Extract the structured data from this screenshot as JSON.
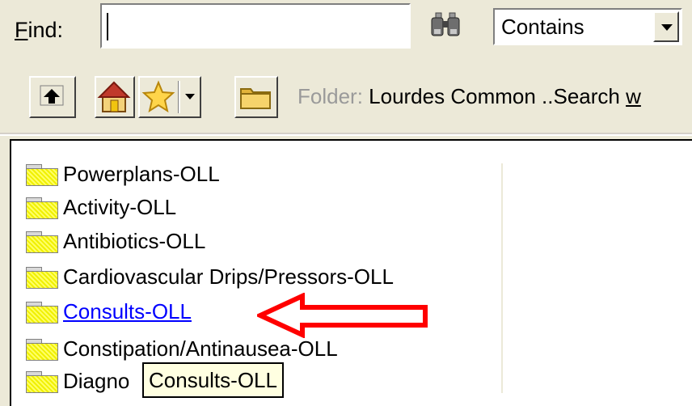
{
  "find": {
    "label_prefix": "",
    "label_accel": "F",
    "label_rest": "ind:",
    "value": ""
  },
  "mode_select": {
    "value": "Contains"
  },
  "toolbar": {
    "folder_prefix": "Folder:",
    "folder_path_start": " Lourdes Common ..Search ",
    "folder_path_end": "w"
  },
  "tree": {
    "items": [
      {
        "label": "Powerplans-OLL"
      },
      {
        "label": "Activity-OLL"
      },
      {
        "label": "Antibiotics-OLL"
      },
      {
        "label": "Cardiovascular Drips/Pressors-OLL"
      },
      {
        "label": "Consults-OLL"
      },
      {
        "label": "Constipation/Antinausea-OLL"
      },
      {
        "label": "Diagno"
      }
    ]
  },
  "tooltip": {
    "text": "Consults-OLL"
  },
  "annotation": {
    "arrow_color": "#ff0000"
  }
}
